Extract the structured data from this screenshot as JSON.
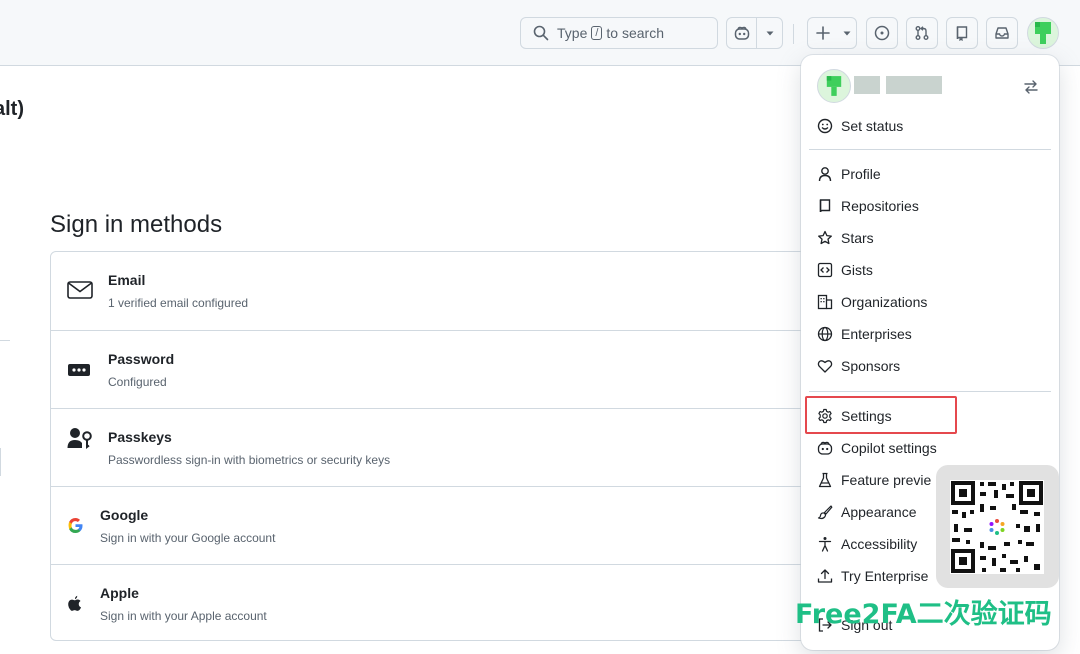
{
  "header": {
    "search_pre": "Type",
    "search_key": "/",
    "search_post": "to search"
  },
  "page": {
    "partial_title": "alt)",
    "section_title": "Sign in methods",
    "methods": [
      {
        "title": "Email",
        "desc": "1 verified email configured",
        "icon": "mail-icon"
      },
      {
        "title": "Password",
        "desc": "Configured",
        "icon": "password-icon"
      },
      {
        "title": "Passkeys",
        "desc": "Passwordless sign-in with biometrics or security keys",
        "icon": "passkey-icon"
      },
      {
        "title": "Google",
        "desc": "Sign in with your Google account",
        "icon": "google-icon"
      },
      {
        "title": "Apple",
        "desc": "Sign in with your Apple account",
        "icon": "apple-icon"
      }
    ]
  },
  "menu": {
    "set_status": "Set status",
    "items": [
      {
        "label": "Profile",
        "icon": "person-icon"
      },
      {
        "label": "Repositories",
        "icon": "repo-icon"
      },
      {
        "label": "Stars",
        "icon": "star-icon"
      },
      {
        "label": "Gists",
        "icon": "code-square-icon"
      },
      {
        "label": "Organizations",
        "icon": "organization-icon"
      },
      {
        "label": "Enterprises",
        "icon": "globe-icon"
      },
      {
        "label": "Sponsors",
        "icon": "heart-icon"
      },
      {
        "label": "Settings",
        "icon": "gear-icon"
      },
      {
        "label": "Copilot settings",
        "icon": "copilot-icon"
      },
      {
        "label": "Feature previe",
        "icon": "beaker-icon"
      },
      {
        "label": "Appearance",
        "icon": "paintbrush-icon"
      },
      {
        "label": "Accessibility",
        "icon": "accessibility-icon"
      },
      {
        "label": "Try Enterprise",
        "icon": "upload-icon"
      },
      {
        "label": "Sign out",
        "icon": "sign-out-icon"
      }
    ]
  },
  "watermark": {
    "brand": "Free2FA二次验证码"
  },
  "colors": {
    "accent_highlight": "#e5484d",
    "brand_green": "#1fbf86",
    "border": "#d1d9e0"
  }
}
